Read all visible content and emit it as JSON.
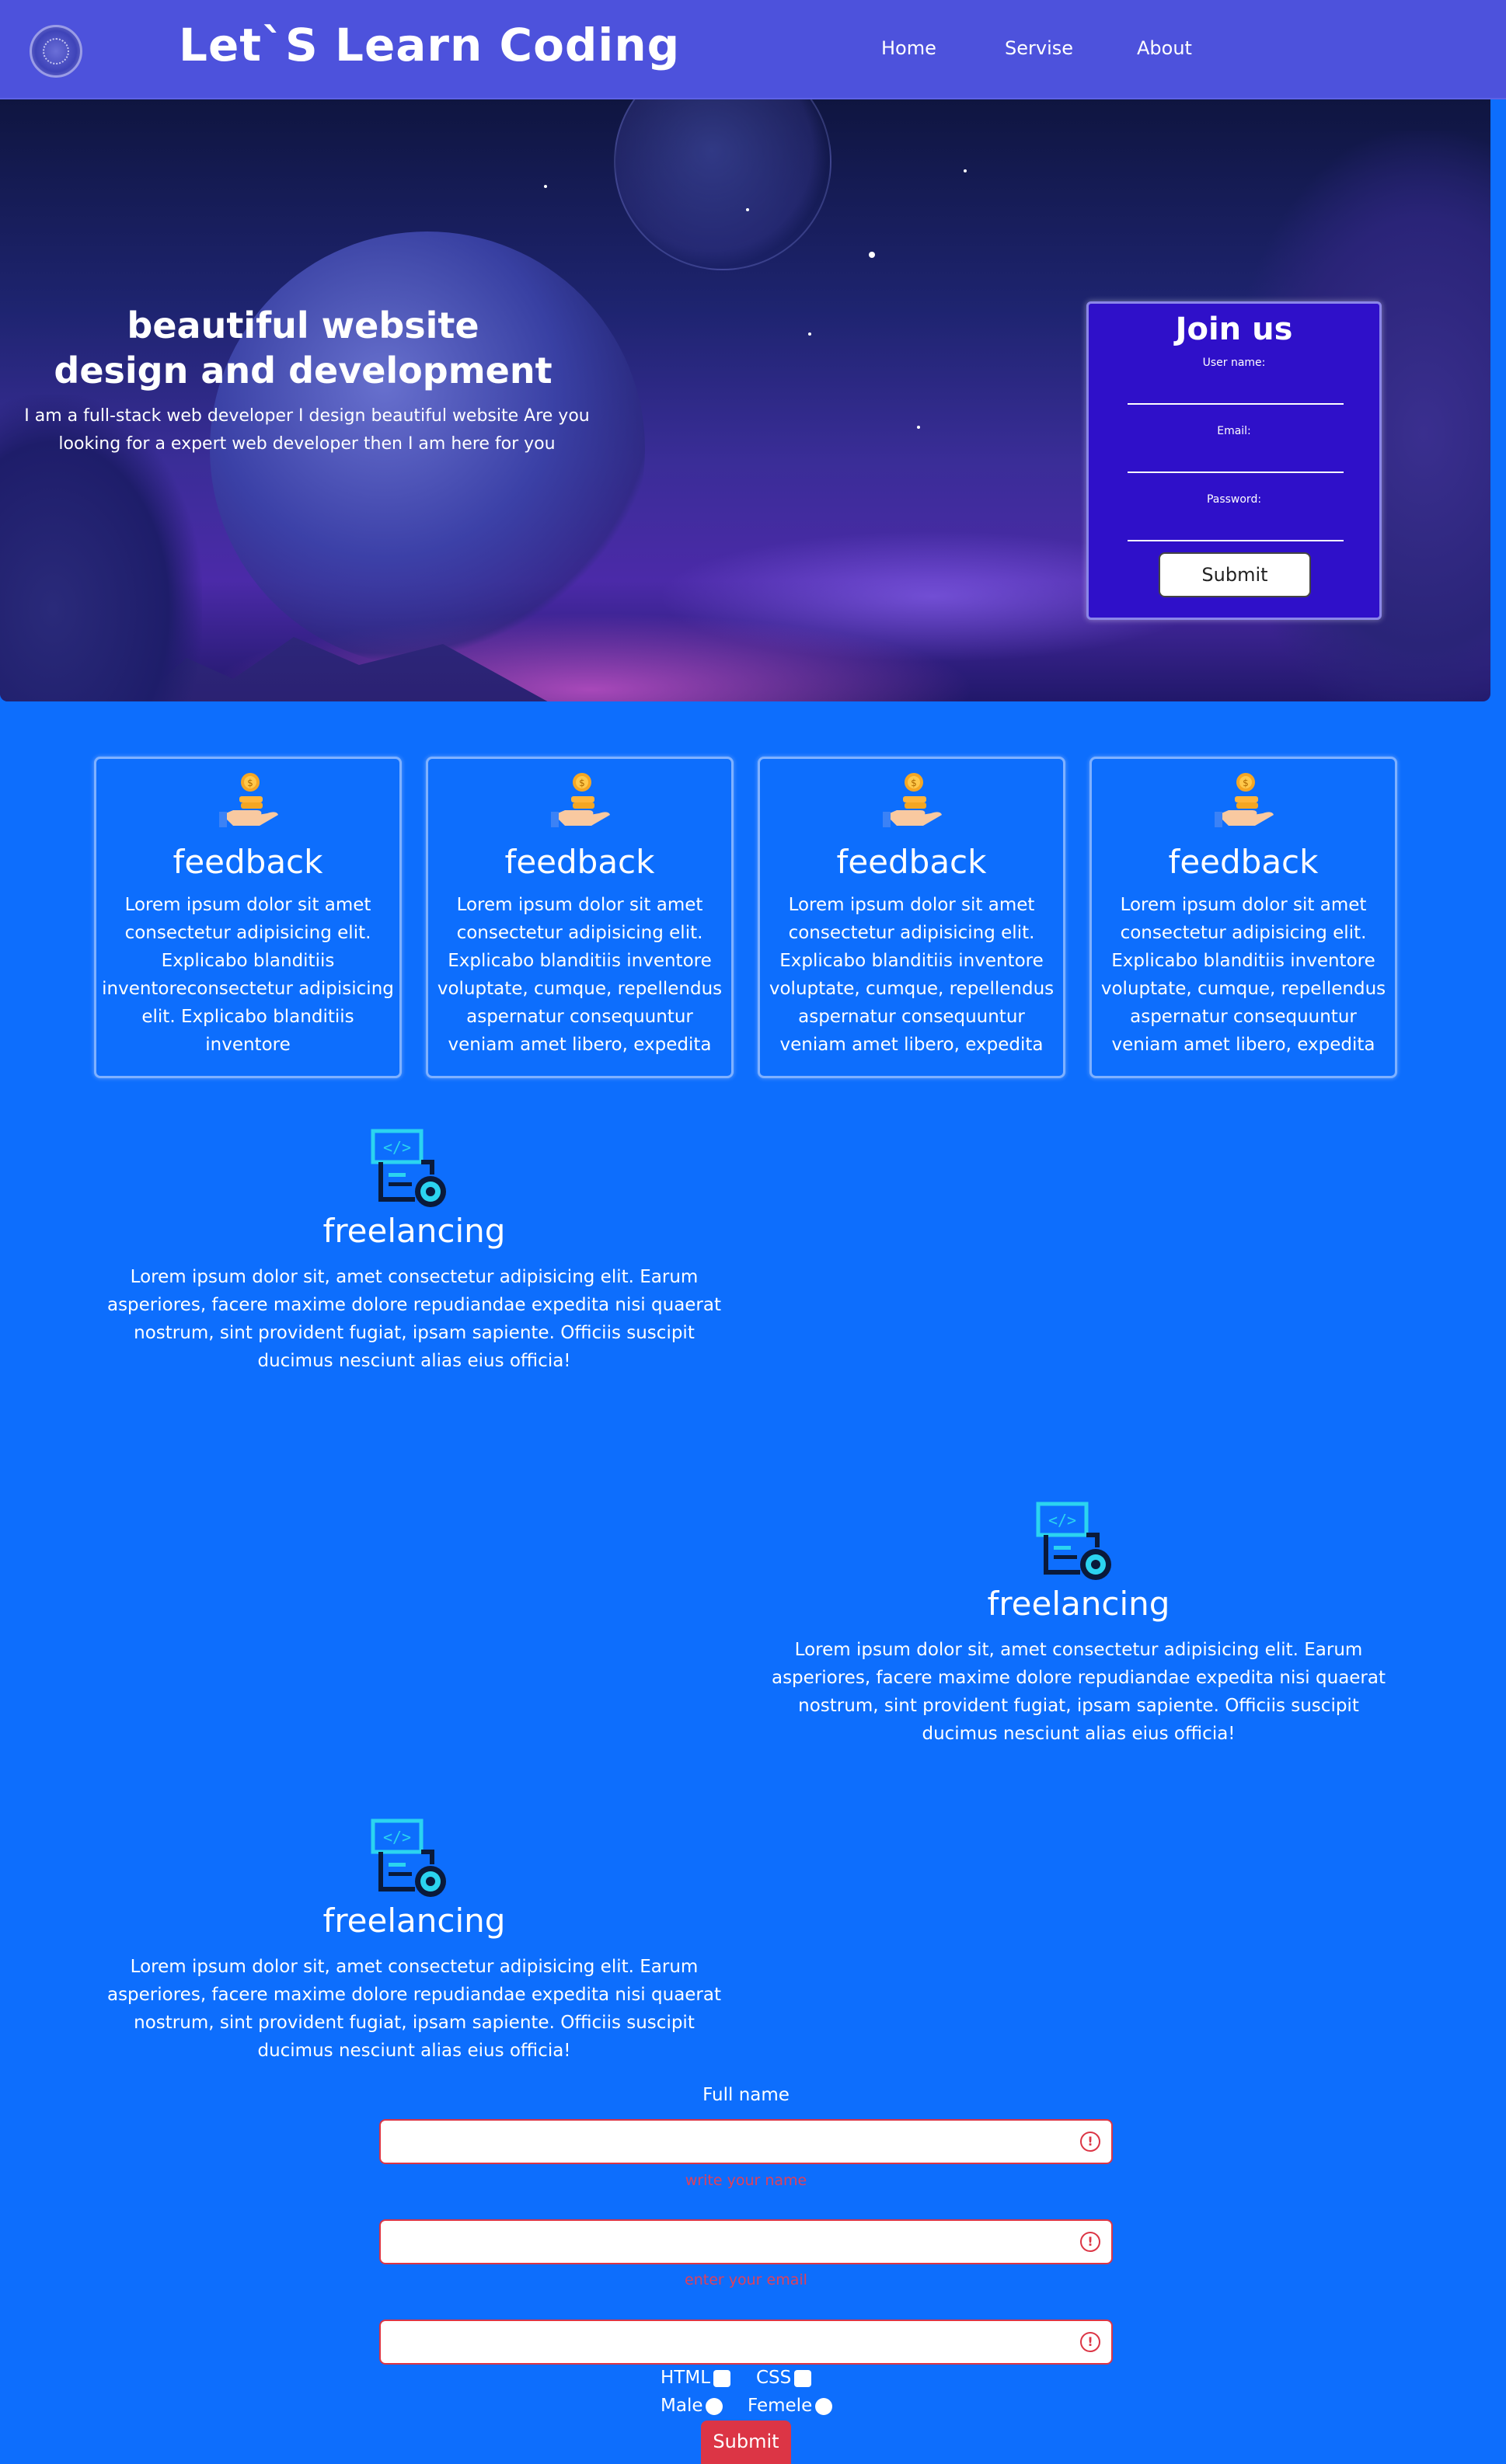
{
  "navbar": {
    "brand": "Let`S Learn Coding",
    "links": [
      "Home",
      "Servise",
      "About"
    ]
  },
  "hero": {
    "title_line1": "beautiful website",
    "title_line2": "design and development",
    "text": "I am a full-stack web developer I design beautiful website Are you looking for a expert web developer then I am here for you"
  },
  "join": {
    "title": "Join us",
    "username_label": "User name:",
    "email_label": "Email:",
    "password_label": "Password:",
    "submit_label": "Submit"
  },
  "feedback_cards": [
    {
      "title": "feedback",
      "text": "Lorem ipsum dolor sit amet consectetur adipisicing elit. Explicabo blanditiis inventoreconsectetur adipisicing elit. Explicabo blanditiis inventore"
    },
    {
      "title": "feedback",
      "text": "Lorem ipsum dolor sit amet consectetur adipisicing elit. Explicabo blanditiis inventore voluptate, cumque, repellendus aspernatur consequuntur veniam amet libero, expedita"
    },
    {
      "title": "feedback",
      "text": "Lorem ipsum dolor sit amet consectetur adipisicing elit. Explicabo blanditiis inventore voluptate, cumque, repellendus aspernatur consequuntur veniam amet libero, expedita"
    },
    {
      "title": "feedback",
      "text": "Lorem ipsum dolor sit amet consectetur adipisicing elit. Explicabo blanditiis inventore voluptate, cumque, repellendus aspernatur consequuntur veniam amet libero, expedita"
    }
  ],
  "freelancing": [
    {
      "title": "freelancing",
      "text": "Lorem ipsum dolor sit, amet consectetur adipisicing elit. Earum asperiores, facere maxime dolore repudiandae expedita nisi quaerat nostrum, sint provident fugiat, ipsam sapiente. Officiis suscipit ducimus nesciunt alias eius officia!"
    },
    {
      "title": "freelancing",
      "text": "Lorem ipsum dolor sit, amet consectetur adipisicing elit. Earum asperiores, facere maxime dolore repudiandae expedita nisi quaerat nostrum, sint provident fugiat, ipsam sapiente. Officiis suscipit ducimus nesciunt alias eius officia!"
    },
    {
      "title": "freelancing",
      "text": "Lorem ipsum dolor sit, amet consectetur adipisicing elit. Earum asperiores, facere maxime dolore repudiandae expedita nisi quaerat nostrum, sint provident fugiat, ipsam sapiente. Officiis suscipit ducimus nesciunt alias eius officia!"
    }
  ],
  "form": {
    "full_name_label": "Full name",
    "name_invalid": "write your name",
    "email_invalid": "enter your email",
    "html_label": "HTML",
    "css_label": "CSS",
    "male_label": "Male",
    "female_label": "Femele",
    "submit_label": "Submit"
  },
  "icons": {
    "logo": "logo-emblem",
    "feedback": "coin-hand-icon",
    "freelancing": "code-settings-icon",
    "invalid": "exclamation-circle-icon"
  },
  "colors": {
    "background": "#0d6efd",
    "navbar": "#4d52dc",
    "join_card": "#2f10c9",
    "danger": "#dc3545"
  }
}
